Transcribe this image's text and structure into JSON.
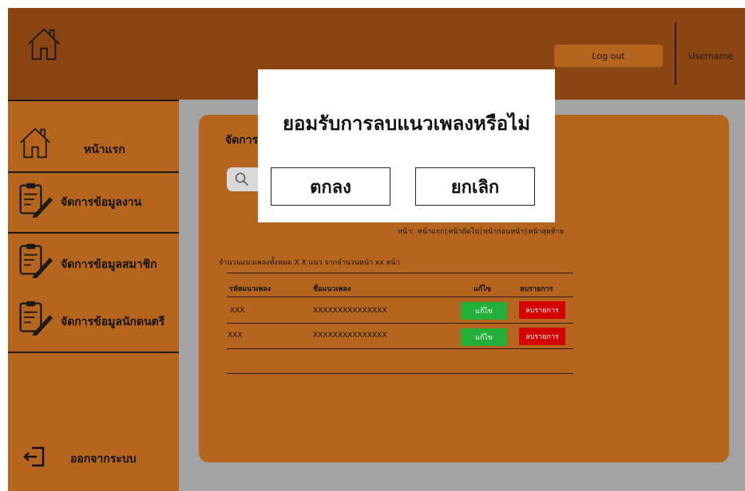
{
  "header": {
    "logout_label": "Log out",
    "username": "Username"
  },
  "sidebar": {
    "items": [
      {
        "label": "หน้าแรก",
        "icon": "home-icon"
      },
      {
        "label": "จัดการข้อมูลงาน",
        "icon": "document-edit-icon"
      },
      {
        "label": "จัดการข้อมูลสมาชิก",
        "icon": "document-edit-icon"
      },
      {
        "label": "จัดการข้อมูลนักดนตรี",
        "icon": "document-edit-icon"
      }
    ],
    "logout_label": "ออกจากระบบ"
  },
  "main": {
    "title": "จัดการ",
    "search_icon": "search-icon",
    "pagination": {
      "prefix": "หน้า:",
      "first": "หน้าแรก",
      "next": "หน้าถัดไป",
      "previous": "หน้าก่อนหน้า",
      "last": "หน้าสุดท้าย"
    },
    "summary": "จำนวนแนวเพลงทั้งหมด X X แนว จากจำนวนหน้า xx หน้า",
    "table": {
      "columns": [
        "รหัสแนวเพลง",
        "ชื่อแนวเพลง",
        "แก้ไข",
        "ลบรายการ"
      ],
      "rows": [
        {
          "id": "XXX",
          "name": "XXXXXXXXXXXXXXX",
          "edit": "แก้ไข",
          "delete": "ลบรายการ"
        },
        {
          "id": "XXX",
          "name": "XXXXXXXXXXXXXXX",
          "edit": "แก้ไข",
          "delete": "ลบรายการ"
        }
      ]
    }
  },
  "modal": {
    "title": "ยอมรับการลบแนวเพลงหรือไม่",
    "confirm_label": "ตกลง",
    "cancel_label": "ยกเลิก"
  },
  "colors": {
    "header": "#8b4513",
    "sidebar": "#b5651d",
    "panel": "#b5651d",
    "content_bg": "#a3a3a3",
    "edit": "#22b03a",
    "delete": "#d40000"
  }
}
